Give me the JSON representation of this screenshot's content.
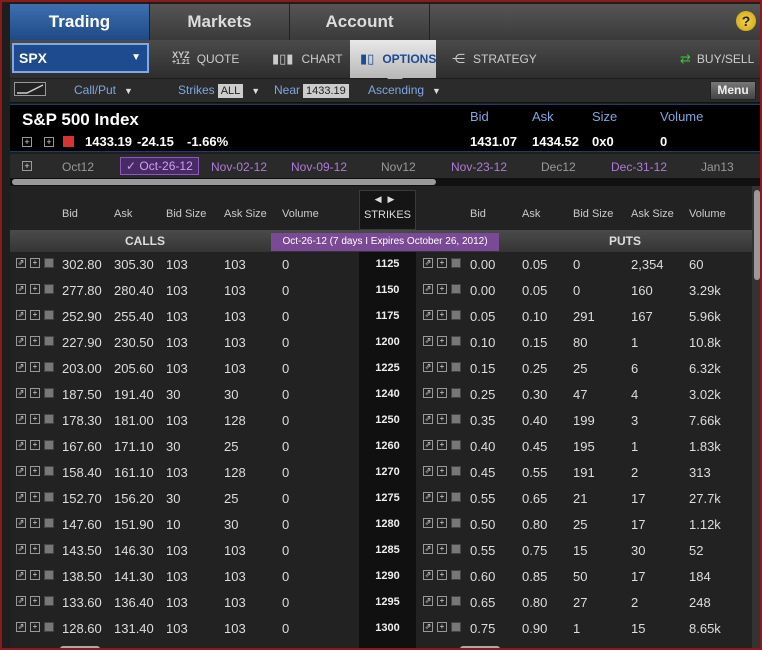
{
  "nav": {
    "tabs": [
      "Trading",
      "Markets",
      "Account"
    ],
    "help": "?"
  },
  "toolbar": {
    "symbol": "SPX",
    "quote_label": "QUOTE",
    "xyz_top": "XYZ",
    "xyz_bottom": "+1.21",
    "chart_label": "CHART",
    "options_label": "OPTIONS",
    "strategy_label": "STRATEGY",
    "buysell_label": "BUY/SELL"
  },
  "filters": {
    "type": "Call/Put",
    "strikes_label": "Strikes",
    "strikes_value": "ALL",
    "near_label": "Near",
    "near_value": "1433.19",
    "sort": "Ascending",
    "menu": "Menu"
  },
  "quote": {
    "name": "S&P 500 Index",
    "last": "1433.19",
    "change": "-24.15",
    "change_pct": "-1.66%",
    "bid_label": "Bid",
    "bid": "1431.07",
    "ask_label": "Ask",
    "ask": "1434.52",
    "size_label": "Size",
    "size": "0x0",
    "volume_label": "Volume",
    "volume": "0"
  },
  "expirations": [
    "Oct12",
    "Oct-26-12",
    "Nov-02-12",
    "Nov-09-12",
    "Nov12",
    "Nov-23-12",
    "Dec12",
    "Dec-31-12",
    "Jan13"
  ],
  "chain": {
    "headers": [
      "Bid",
      "Ask",
      "Bid Size",
      "Ask Size",
      "Volume"
    ],
    "strikes_label": "STRIKES",
    "calls_label": "CALLS",
    "puts_label": "PUTS",
    "expiry_badge": "Oct-26-12   (7 days I Expires October 26, 2012)",
    "rows": [
      {
        "strike": "1125",
        "call": [
          "302.80",
          "305.30",
          "103",
          "103",
          "0"
        ],
        "put": [
          "0.00",
          "0.05",
          "0",
          "2,354",
          "60"
        ]
      },
      {
        "strike": "1150",
        "call": [
          "277.80",
          "280.40",
          "103",
          "103",
          "0"
        ],
        "put": [
          "0.00",
          "0.05",
          "0",
          "160",
          "3.29k"
        ]
      },
      {
        "strike": "1175",
        "call": [
          "252.90",
          "255.40",
          "103",
          "103",
          "0"
        ],
        "put": [
          "0.05",
          "0.10",
          "291",
          "167",
          "5.96k"
        ]
      },
      {
        "strike": "1200",
        "call": [
          "227.90",
          "230.50",
          "103",
          "103",
          "0"
        ],
        "put": [
          "0.10",
          "0.15",
          "80",
          "1",
          "10.8k"
        ]
      },
      {
        "strike": "1225",
        "call": [
          "203.00",
          "205.60",
          "103",
          "103",
          "0"
        ],
        "put": [
          "0.15",
          "0.25",
          "25",
          "6",
          "6.32k"
        ]
      },
      {
        "strike": "1240",
        "call": [
          "187.50",
          "191.40",
          "30",
          "30",
          "0"
        ],
        "put": [
          "0.25",
          "0.30",
          "47",
          "4",
          "3.02k"
        ]
      },
      {
        "strike": "1250",
        "call": [
          "178.30",
          "181.00",
          "103",
          "128",
          "0"
        ],
        "put": [
          "0.35",
          "0.40",
          "199",
          "3",
          "7.66k"
        ]
      },
      {
        "strike": "1260",
        "call": [
          "167.60",
          "171.10",
          "30",
          "25",
          "0"
        ],
        "put": [
          "0.40",
          "0.45",
          "195",
          "1",
          "1.83k"
        ]
      },
      {
        "strike": "1270",
        "call": [
          "158.40",
          "161.10",
          "103",
          "128",
          "0"
        ],
        "put": [
          "0.45",
          "0.55",
          "191",
          "2",
          "313"
        ]
      },
      {
        "strike": "1275",
        "call": [
          "152.70",
          "156.20",
          "30",
          "25",
          "0"
        ],
        "put": [
          "0.55",
          "0.65",
          "21",
          "17",
          "27.7k"
        ]
      },
      {
        "strike": "1280",
        "call": [
          "147.60",
          "151.90",
          "10",
          "30",
          "0"
        ],
        "put": [
          "0.50",
          "0.80",
          "25",
          "17",
          "1.12k"
        ]
      },
      {
        "strike": "1285",
        "call": [
          "143.50",
          "146.30",
          "103",
          "103",
          "0"
        ],
        "put": [
          "0.55",
          "0.75",
          "15",
          "30",
          "52"
        ]
      },
      {
        "strike": "1290",
        "call": [
          "138.50",
          "141.30",
          "103",
          "103",
          "0"
        ],
        "put": [
          "0.60",
          "0.85",
          "50",
          "17",
          "184"
        ]
      },
      {
        "strike": "1295",
        "call": [
          "133.60",
          "136.40",
          "103",
          "103",
          "0"
        ],
        "put": [
          "0.65",
          "0.80",
          "27",
          "2",
          "248"
        ]
      },
      {
        "strike": "1300",
        "call": [
          "128.60",
          "131.40",
          "103",
          "103",
          "0"
        ],
        "put": [
          "0.75",
          "0.90",
          "1",
          "15",
          "8.65k"
        ]
      }
    ]
  }
}
